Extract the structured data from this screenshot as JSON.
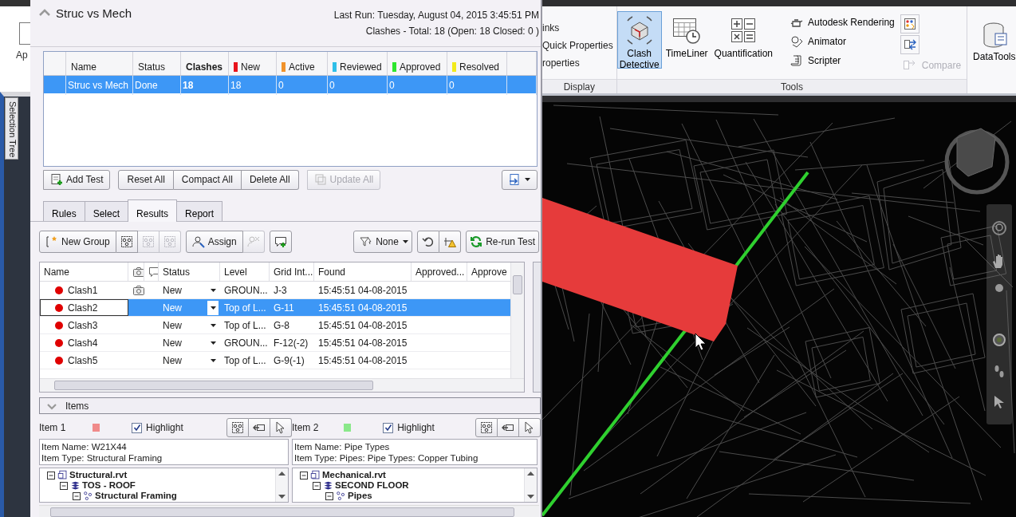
{
  "side_strip": {
    "button_label": "Ap",
    "tab_label": "Selection Tree"
  },
  "test_header": {
    "title": "Struc vs Mech",
    "expanded": true,
    "last_run": "Last Run:  Tuesday, August 04, 2015 3:45:51 PM",
    "summary": "Clashes -  Total:  18  (Open:  18  Closed:  0 )"
  },
  "tests_table": {
    "columns": [
      {
        "label": "Name",
        "sorted": false
      },
      {
        "label": "Status",
        "sorted": false
      },
      {
        "label": "Clashes",
        "sorted": true
      },
      {
        "label": "New",
        "sorted": false,
        "color": "#e8141c"
      },
      {
        "label": "Active",
        "sorted": false,
        "color": "#f0922a"
      },
      {
        "label": "Reviewed",
        "sorted": false,
        "color": "#2fbfe8"
      },
      {
        "label": "Approved",
        "sorted": false,
        "color": "#2ee62e"
      },
      {
        "label": "Resolved",
        "sorted": false,
        "color": "#f2ea1c"
      }
    ],
    "rows": [
      {
        "selected": true,
        "cells": [
          "Struc vs Mech",
          "Done",
          "18",
          "18",
          "0",
          "0",
          "0",
          "0"
        ]
      }
    ]
  },
  "test_actions": [
    [
      {
        "label": "Add Test",
        "disabled": false
      }
    ],
    [
      {
        "label": "Reset All",
        "disabled": false
      },
      {
        "label": "Compact All",
        "disabled": false
      },
      {
        "label": "Delete All",
        "disabled": false
      }
    ],
    [
      {
        "label": "Update All",
        "disabled": true
      }
    ]
  ],
  "tabs": [
    {
      "label": "Rules",
      "selected": false
    },
    {
      "label": "Select",
      "selected": false
    },
    {
      "label": "Results",
      "selected": true
    },
    {
      "label": "Report",
      "selected": false
    }
  ],
  "results_toolbar": {
    "new_group": "New Group",
    "group_buttons": [
      {
        "disabled": false
      },
      {
        "disabled": true
      },
      {
        "disabled": true
      }
    ],
    "assign": "Assign",
    "unassign_disabled": true,
    "filter": "None",
    "rerun": "Re-run Test"
  },
  "results_table": {
    "columns": [
      {
        "kind": "text",
        "label": "Name"
      },
      {
        "kind": "camera"
      },
      {
        "kind": "comment"
      },
      {
        "kind": "text",
        "label": "Status"
      },
      {
        "kind": "text",
        "label": "Level"
      },
      {
        "kind": "text",
        "label": "Grid Int..."
      },
      {
        "kind": "text",
        "label": "Found"
      },
      {
        "kind": "text",
        "label": "Approved..."
      },
      {
        "kind": "text",
        "label": "Approve"
      }
    ],
    "rows": [
      {
        "name": "Clash1",
        "color": "#e00000",
        "viewpoint": true,
        "status": "New",
        "level": "GROUN...",
        "grid": "J-3",
        "found": "15:45:51 04-08-2015",
        "selected": false,
        "focused": false
      },
      {
        "name": "Clash2",
        "color": "#e00000",
        "viewpoint": false,
        "status": "New",
        "level": "Top of L...",
        "grid": "G-11",
        "found": "15:45:51 04-08-2015",
        "selected": true,
        "focused": true
      },
      {
        "name": "Clash3",
        "color": "#e00000",
        "viewpoint": false,
        "status": "New",
        "level": "Top of L...",
        "grid": "G-8",
        "found": "15:45:51 04-08-2015",
        "selected": false,
        "focused": false
      },
      {
        "name": "Clash4",
        "color": "#e00000",
        "viewpoint": false,
        "status": "New",
        "level": "GROUN...",
        "grid": "F-12(-2)",
        "found": "15:45:51 04-08-2015",
        "selected": false,
        "focused": false
      },
      {
        "name": "Clash5",
        "color": "#e00000",
        "viewpoint": false,
        "status": "New",
        "level": "Top of L...",
        "grid": "G-9(-1)",
        "found": "15:45:51 04-08-2015",
        "selected": false,
        "focused": false
      }
    ]
  },
  "items_section": {
    "title": "Items",
    "expanded": true,
    "items": [
      {
        "label": "Item 1",
        "color": "#f08a8a",
        "highlight": true,
        "highlight_label": "Highlight",
        "details": [
          "Item Name: W21X44",
          "Item Type: Structural Framing"
        ],
        "tree": [
          {
            "label": "Structural.rvt",
            "kind": "file",
            "expanded": true,
            "children": [
              {
                "label": "TOS - ROOF",
                "kind": "level",
                "expanded": true,
                "children": [
                  {
                    "label": "Structural Framing",
                    "kind": "category",
                    "expanded": true
                  }
                ]
              }
            ]
          }
        ]
      },
      {
        "label": "Item 2",
        "color": "#8ae88a",
        "highlight": true,
        "highlight_label": "Highlight",
        "details": [
          "Item Name: Pipe Types",
          "Item Type: Pipes: Pipe Types: Copper Tubing"
        ],
        "tree": [
          {
            "label": "Mechanical.rvt",
            "kind": "file",
            "expanded": true,
            "children": [
              {
                "label": "SECOND FLOOR",
                "kind": "level",
                "expanded": true,
                "children": [
                  {
                    "label": "Pipes",
                    "kind": "category",
                    "expanded": true
                  }
                ]
              }
            ]
          }
        ]
      }
    ]
  },
  "ribbon": {
    "display_items": [
      "inks",
      "Quick Properties",
      "roperties"
    ],
    "display_group": "Display",
    "large_tools": [
      {
        "label": "Clash Detective",
        "selected": true
      },
      {
        "label": "TimeLiner",
        "selected": false
      },
      {
        "label": "Quantification",
        "selected": false
      }
    ],
    "small_tools": [
      {
        "label": "Autodesk Rendering",
        "disabled": false
      },
      {
        "label": "Animator",
        "disabled": false
      },
      {
        "label": "Scripter",
        "disabled": false
      }
    ],
    "compare": {
      "label": "Compare",
      "disabled": true
    },
    "tools_group": "Tools",
    "data_tools": "DataTools"
  }
}
